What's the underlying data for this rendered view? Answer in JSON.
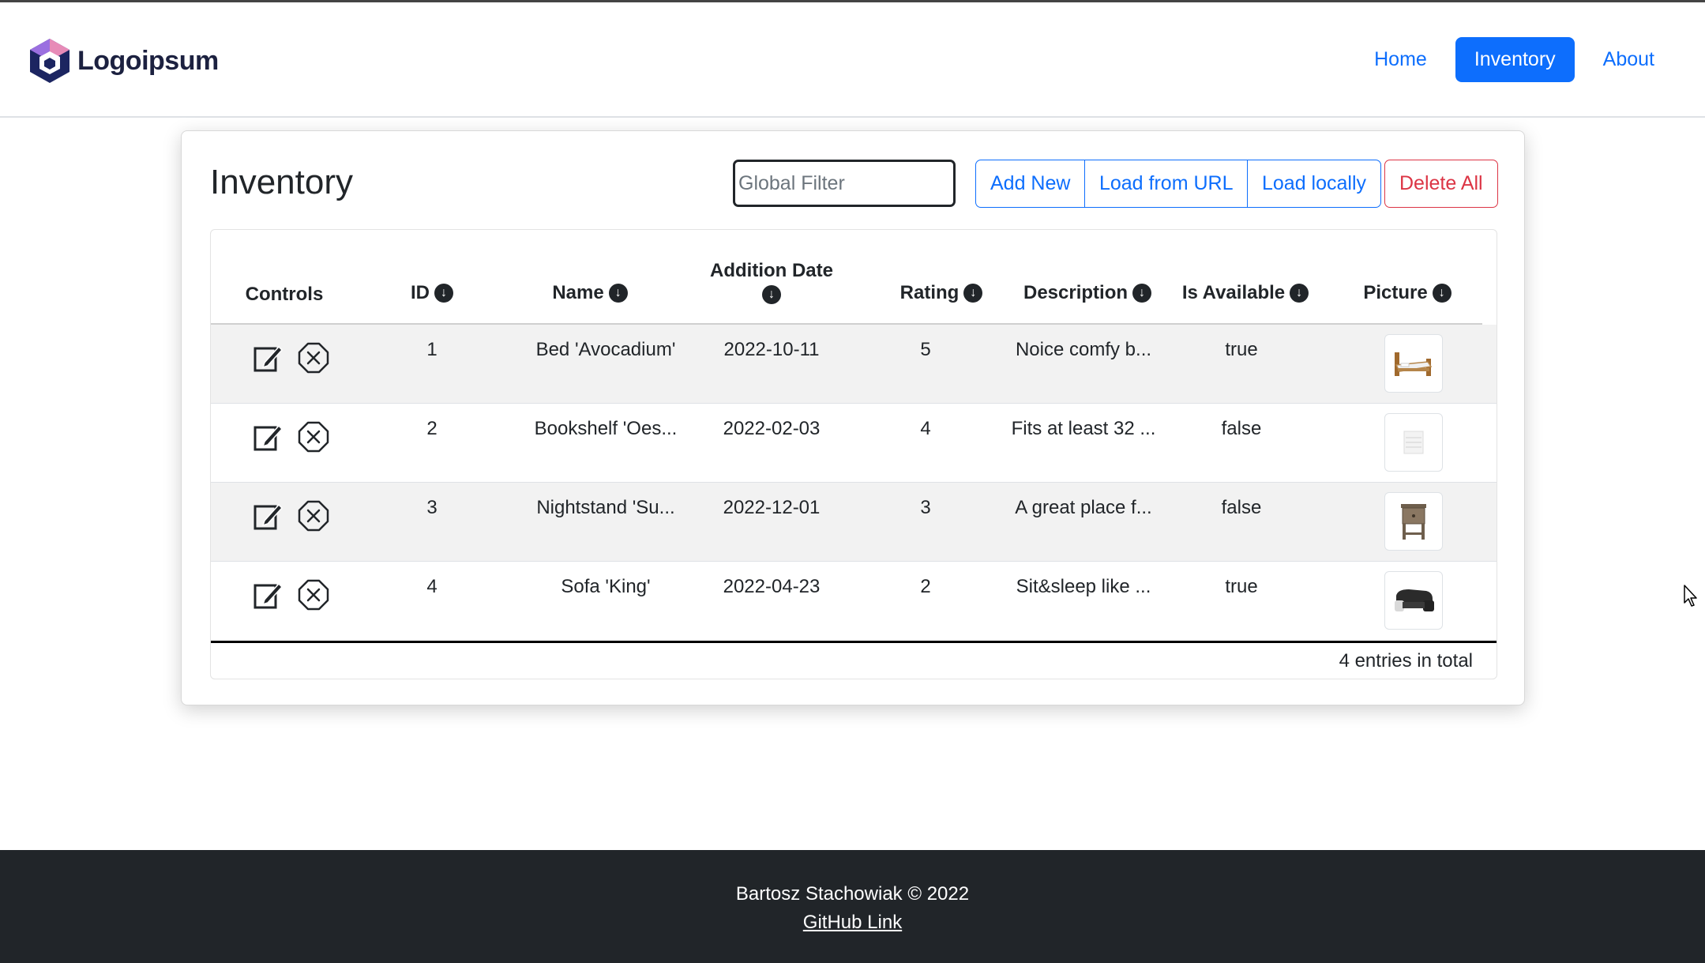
{
  "brand": {
    "name": "Logoipsum"
  },
  "nav": {
    "items": [
      {
        "label": "Home",
        "active": false
      },
      {
        "label": "Inventory",
        "active": true
      },
      {
        "label": "About",
        "active": false
      }
    ]
  },
  "card": {
    "title": "Inventory",
    "filter_placeholder": "Global Filter",
    "buttons": {
      "add_new": "Add New",
      "load_url": "Load from URL",
      "load_local": "Load locally",
      "delete_all": "Delete All"
    }
  },
  "table": {
    "columns": {
      "controls": "Controls",
      "id": "ID",
      "name": "Name",
      "date": "Addition Date",
      "rating": "Rating",
      "description": "Description",
      "available": "Is Available",
      "picture": "Picture"
    },
    "rows": [
      {
        "id": "1",
        "name": "Bed 'Avocadium'",
        "date": "2022-10-11",
        "rating": "5",
        "description": "Noice comfy b...",
        "available": "true",
        "picture": "bed-picture"
      },
      {
        "id": "2",
        "name": "Bookshelf 'Oes...",
        "date": "2022-02-03",
        "rating": "4",
        "description": "Fits at least 32 ...",
        "available": "false",
        "picture": "bookshelf-picture"
      },
      {
        "id": "3",
        "name": "Nightstand 'Su...",
        "date": "2022-12-01",
        "rating": "3",
        "description": "A great place f...",
        "available": "false",
        "picture": "nightstand-picture"
      },
      {
        "id": "4",
        "name": "Sofa 'King'",
        "date": "2022-04-23",
        "rating": "2",
        "description": "Sit&sleep like ...",
        "available": "true",
        "picture": "sofa-picture"
      }
    ],
    "total": "4 entries in total"
  },
  "footer": {
    "text": "Bartosz Stachowiak © 2022",
    "link": "GitHub Link"
  },
  "colors": {
    "primary": "#0d6efd",
    "danger": "#dc3545",
    "footer_bg": "#212529",
    "stripe": "#f2f2f2"
  }
}
